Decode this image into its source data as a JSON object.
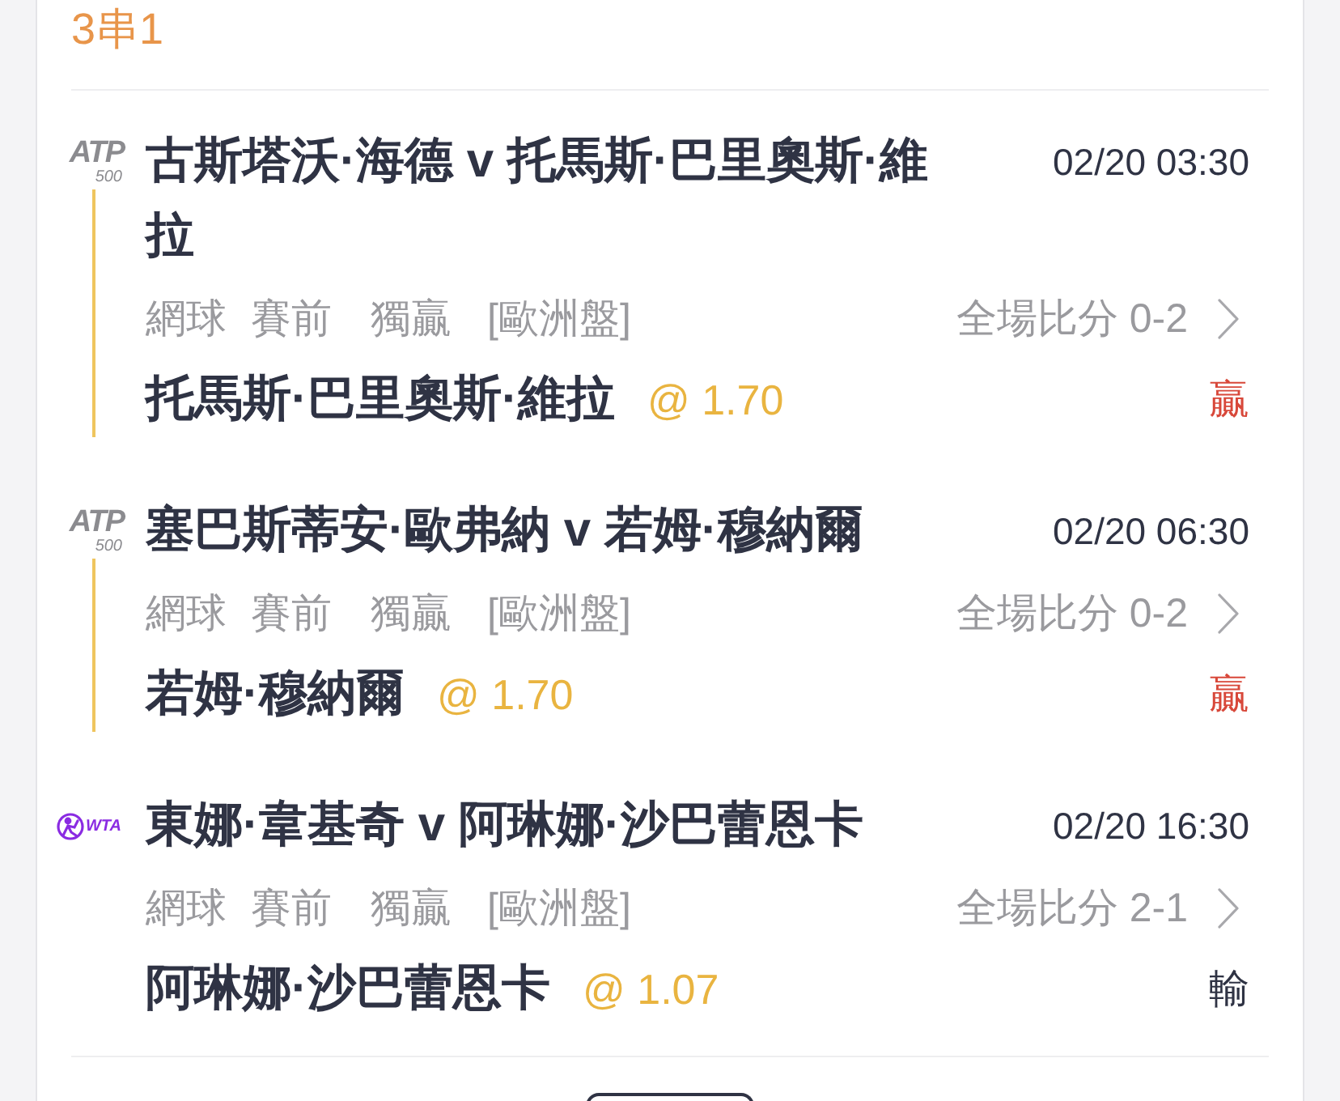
{
  "bet": {
    "title": "3串1"
  },
  "legs": [
    {
      "league_logo": {
        "kind": "atp",
        "text": "ATP",
        "tier": "500"
      },
      "match": "古斯塔沃·海德 v 托馬斯·巴里奧斯·維拉",
      "time": "02/20 03:30",
      "sport": "網球",
      "stage": "賽前",
      "market": "獨贏",
      "odds_type": "[歐洲盤]",
      "score": "全場比分 0-2",
      "pick": "托馬斯·巴里奧斯·維拉",
      "odds": "@ 1.70",
      "result": {
        "kind": "win",
        "text": "贏"
      }
    },
    {
      "league_logo": {
        "kind": "atp",
        "text": "ATP",
        "tier": "500"
      },
      "match": "塞巴斯蒂安·歐弗納 v 若姆·穆納爾",
      "time": "02/20 06:30",
      "sport": "網球",
      "stage": "賽前",
      "market": "獨贏",
      "odds_type": "[歐洲盤]",
      "score": "全場比分 0-2",
      "pick": "若姆·穆納爾",
      "odds": "@ 1.70",
      "result": {
        "kind": "win",
        "text": "贏"
      }
    },
    {
      "league_logo": {
        "kind": "wta",
        "text": "WTA"
      },
      "match": "東娜·韋基奇 v 阿琳娜·沙巴蕾恩卡",
      "time": "02/20 16:30",
      "sport": "網球",
      "stage": "賽前",
      "market": "獨贏",
      "odds_type": "[歐洲盤]",
      "score": "全場比分 2-1",
      "pick": "阿琳娜·沙巴蕾恩卡",
      "odds": "@ 1.07",
      "result": {
        "kind": "lose",
        "text": "輸"
      }
    }
  ]
}
